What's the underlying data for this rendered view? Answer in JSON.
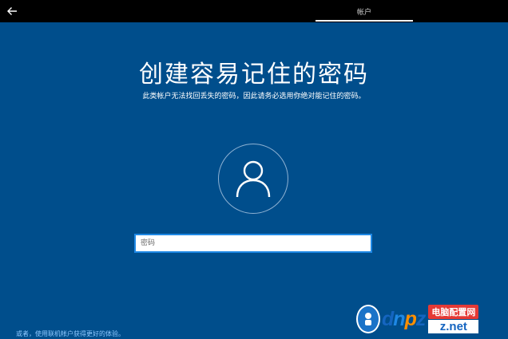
{
  "header": {
    "back_icon": "arrow-left-icon",
    "tab_label": "帐户"
  },
  "main": {
    "title": "创建容易记住的密码",
    "subtitle": "此类帐户无法找回丢失的密码，因此请务必选用你绝对能记住的密码。",
    "avatar_icon": "user-icon",
    "password": {
      "value": "",
      "placeholder": "密码"
    }
  },
  "footer": {
    "link": "或者，使用联机帐户获得更好的体验。"
  },
  "watermark": {
    "brand": "dnpz",
    "site_name": "电脑配置网",
    "domain_suffix": "z.net"
  },
  "colors": {
    "background": "#004e8c",
    "topbar": "#000000",
    "field_border": "#1e88e5",
    "link": "#8ec8ff"
  }
}
